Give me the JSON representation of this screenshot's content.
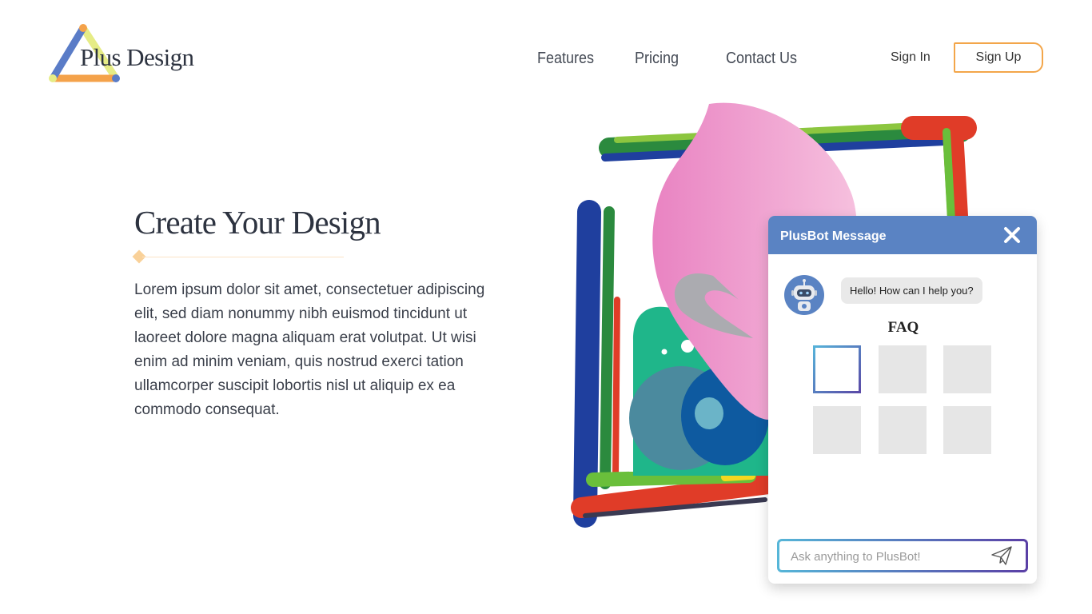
{
  "brand": {
    "name": "Plus Design"
  },
  "nav": {
    "items": [
      "Features",
      "Pricing",
      "Contact Us"
    ],
    "sign_in": "Sign In",
    "sign_up": "Sign Up"
  },
  "hero": {
    "title": "Create Your Design",
    "body": "Lorem ipsum dolor sit amet, consectetuer adipiscing elit, sed diam nonummy nibh euismod tincidunt ut laoreet dolore magna aliquam erat volutpat. Ut wisi enim ad minim veniam, quis nostrud exerci tation ullamcorper suscipit lobortis nisl ut aliquip ex ea commodo consequat."
  },
  "chat": {
    "title": "PlusBot Message",
    "greeting": "Hello! How can I help you?",
    "faq_title": "FAQ",
    "input_placeholder": "Ask anything to PlusBot!"
  },
  "icons": {
    "logo": "triangle-logo-icon",
    "close": "close-icon",
    "bot": "robot-avatar-icon",
    "send": "paper-plane-send-icon"
  },
  "colors": {
    "accent_orange": "#f3a64a",
    "chat_header": "#5a83c3",
    "text_dark": "#2d3340"
  }
}
